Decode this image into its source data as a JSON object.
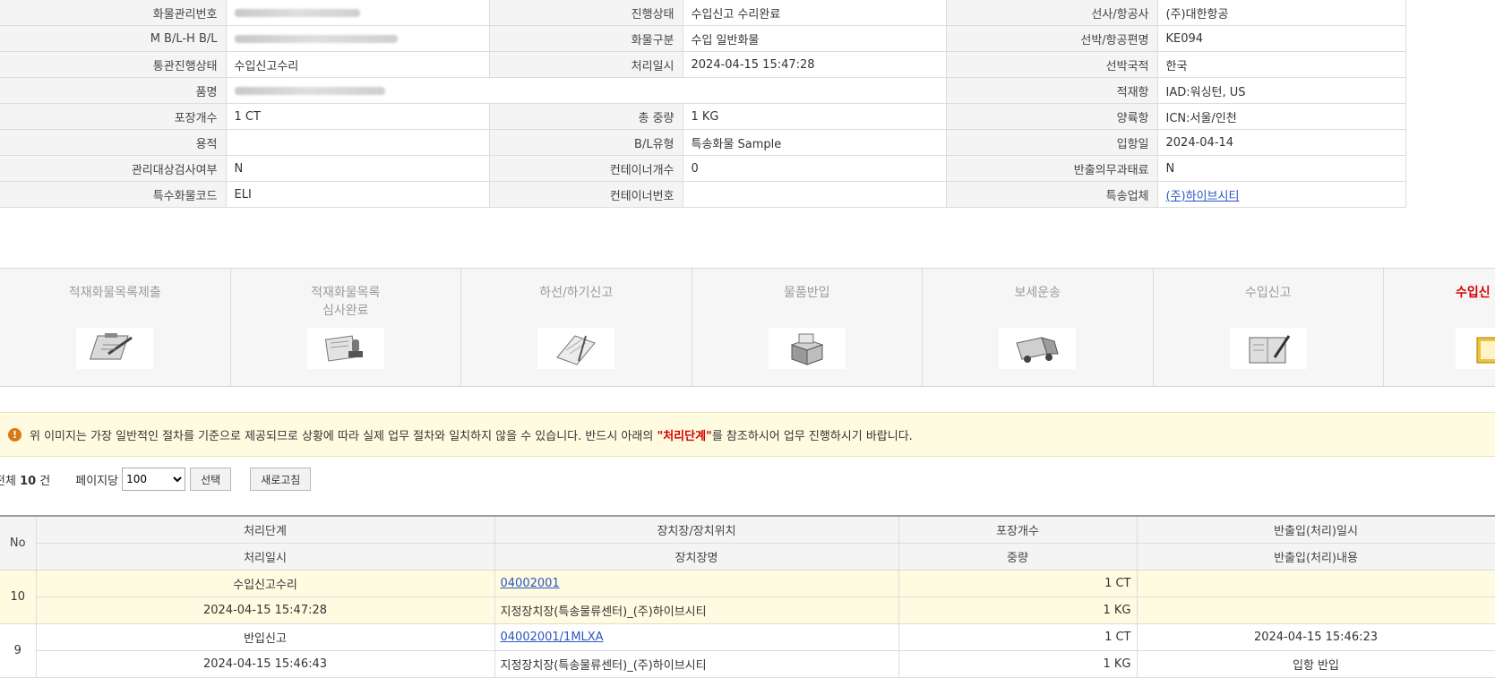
{
  "info": {
    "rows": [
      [
        {
          "label": "화물관리번호",
          "value": "",
          "blurred": true
        },
        {
          "label": "진행상태",
          "value": "수입신고 수리완료"
        },
        {
          "label": "선사/항공사",
          "value": "(주)대한항공"
        }
      ],
      [
        {
          "label": "M B/L-H B/L",
          "value": "",
          "blurred": true
        },
        {
          "label": "화물구분",
          "value": "수입 일반화물"
        },
        {
          "label": "선박/항공편명",
          "value": "KE094"
        }
      ],
      [
        {
          "label": "통관진행상태",
          "value": "수입신고수리"
        },
        {
          "label": "처리일시",
          "value": "2024-04-15 15:47:28"
        },
        {
          "label": "선박국적",
          "value": "한국"
        }
      ],
      [
        {
          "label": "품명",
          "value": "",
          "blurred": true,
          "span": true
        },
        {
          "label": "적재항",
          "value": "IAD:워싱턴, US"
        }
      ],
      [
        {
          "label": "포장개수",
          "value": "1 CT"
        },
        {
          "label": "총 중량",
          "value": "1 KG"
        },
        {
          "label": "양륙항",
          "value": "ICN:서울/인천"
        }
      ],
      [
        {
          "label": "용적",
          "value": ""
        },
        {
          "label": "B/L유형",
          "value": "특송화물 Sample"
        },
        {
          "label": "입항일",
          "value": "2024-04-14"
        }
      ],
      [
        {
          "label": "관리대상검사여부",
          "value": "N"
        },
        {
          "label": "컨테이너개수",
          "value": "0"
        },
        {
          "label": "반출의무과태료",
          "value": "N"
        }
      ],
      [
        {
          "label": "특수화물코드",
          "value": "ELI"
        },
        {
          "label": "컨테이너번호",
          "value": ""
        },
        {
          "label": "특송업체",
          "value": "(주)하이브시티",
          "link": true
        }
      ]
    ]
  },
  "flow": {
    "steps": [
      {
        "label": "적재화물목록제출",
        "icon": "clipboard-icon"
      },
      {
        "label": "적재화물목록\n심사완료",
        "icon": "stamp-icon"
      },
      {
        "label": "하선/하기신고",
        "icon": "notebook-icon"
      },
      {
        "label": "물품반입",
        "icon": "box-icon"
      },
      {
        "label": "보세운송",
        "icon": "truck-icon"
      },
      {
        "label": "수입신고",
        "icon": "document-pen-icon"
      },
      {
        "label": "수입신",
        "icon": "folder-icon",
        "active": true
      }
    ]
  },
  "notice": {
    "text_before": "위 이미지는 가장 일반적인 절차를 기준으로 제공되므로 상황에 따라 실제 업무 절차와 일치하지 않을 수 있습니다. 반드시 아래의 ",
    "highlight": "\"처리단계\"",
    "text_after": "를 참조하시어 업무 진행하시기 바랍니다."
  },
  "list": {
    "total_prefix": "전체 ",
    "total_count": "10",
    "total_suffix": " 건",
    "per_page_label": "페이지당",
    "per_page_value": "100",
    "select_button": "선택",
    "refresh_button": "새로고침"
  },
  "grid": {
    "headers": {
      "no": "No",
      "stage": "처리단계",
      "location": "장치장/장치위치",
      "pkg": "포장개수",
      "io_date": "반출입(처리)일시",
      "proc_date": "처리일시",
      "loc_name": "장치장명",
      "weight": "중량",
      "io_content": "반출입(처리)내용"
    },
    "rows": [
      {
        "no": "10",
        "stage": "수입신고수리",
        "location": "04002001",
        "pkg": "1 CT",
        "io_date": "",
        "proc_date": "2024-04-15 15:47:28",
        "loc_name": "지정장치장(특송물류센터)_(주)하이브시티",
        "weight": "1 KG",
        "io_content": "",
        "highlight": true
      },
      {
        "no": "9",
        "stage": "반입신고",
        "location": "04002001/1MLXA",
        "pkg": "1 CT",
        "io_date": "2024-04-15 15:46:23",
        "proc_date": "2024-04-15 15:46:43",
        "loc_name": "지정장치장(특송물류센터)_(주)하이브시티",
        "weight": "1 KG",
        "io_content": "입항 반입",
        "highlight": false
      }
    ]
  }
}
